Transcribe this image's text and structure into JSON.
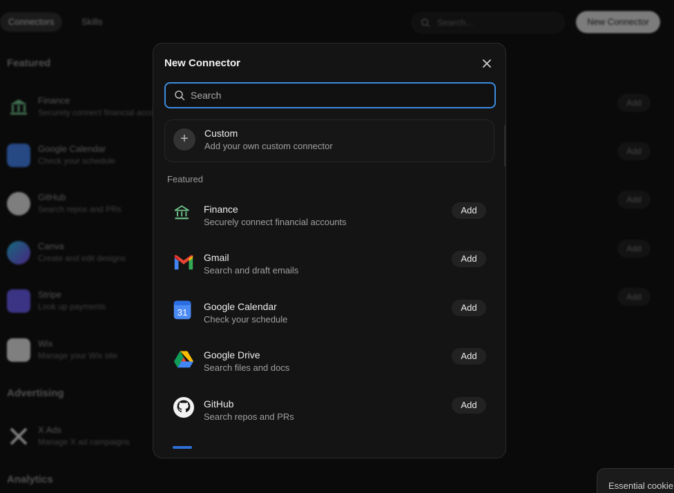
{
  "background": {
    "tabs": [
      "Connectors",
      "Skills"
    ],
    "search_placeholder": "Search...",
    "new_connector_label": "New Connector",
    "sections": {
      "featured": "Featured",
      "advertising": "Advertising",
      "analytics": "Analytics"
    },
    "items": [
      {
        "title": "Finance",
        "subtitle": "Securely connect financial accounts",
        "add": "Add"
      },
      {
        "title": "Google Calendar",
        "subtitle": "Check your schedule",
        "add": "Add"
      },
      {
        "title": "GitHub",
        "subtitle": "Search repos and PRs",
        "add": "Add"
      },
      {
        "title": "Canva",
        "subtitle": "Create and edit designs",
        "add": "Add"
      },
      {
        "title": "Stripe",
        "subtitle": "Look up payments",
        "add": "Add"
      },
      {
        "title": "Wix",
        "subtitle": "Manage your Wix site"
      },
      {
        "title": "X Ads",
        "subtitle": "Manage X ad campaigns"
      }
    ]
  },
  "cookie_banner": {
    "text": "Essential cookie"
  },
  "modal": {
    "title": "New Connector",
    "search_placeholder": "Search",
    "custom": {
      "title": "Custom",
      "subtitle": "Add your own custom connector"
    },
    "featured_label": "Featured",
    "items": [
      {
        "title": "Finance",
        "subtitle": "Securely connect financial accounts",
        "add": "Add",
        "icon": "bank-icon"
      },
      {
        "title": "Gmail",
        "subtitle": "Search and draft emails",
        "add": "Add",
        "icon": "gmail-icon"
      },
      {
        "title": "Google Calendar",
        "subtitle": "Check your schedule",
        "add": "Add",
        "icon": "google-calendar-icon"
      },
      {
        "title": "Google Drive",
        "subtitle": "Search files and docs",
        "add": "Add",
        "icon": "google-drive-icon"
      },
      {
        "title": "GitHub",
        "subtitle": "Search repos and PRs",
        "add": "Add",
        "icon": "github-icon"
      }
    ],
    "calendar_day": "31"
  },
  "colors": {
    "accent_focus": "#3b8de0",
    "finance_icon": "#6fc48a"
  }
}
